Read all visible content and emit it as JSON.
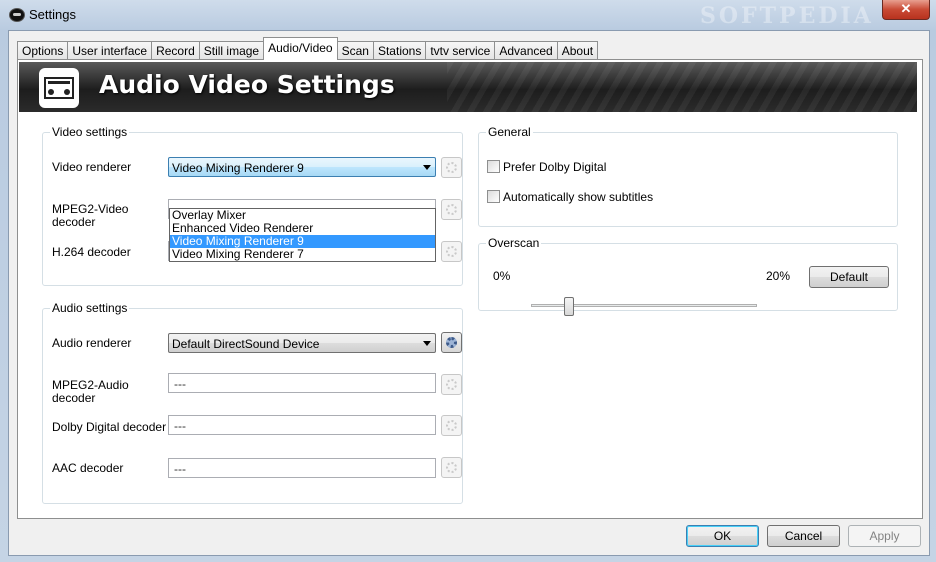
{
  "window": {
    "title": "Settings",
    "close_symbol": "✕",
    "watermark": "SOFTPEDIA"
  },
  "tabs": [
    {
      "label": "Options"
    },
    {
      "label": "User interface"
    },
    {
      "label": "Record"
    },
    {
      "label": "Still image"
    },
    {
      "label": "Audio/Video",
      "active": true
    },
    {
      "label": "Scan"
    },
    {
      "label": "Stations"
    },
    {
      "label": "tvtv service"
    },
    {
      "label": "Advanced"
    },
    {
      "label": "About"
    }
  ],
  "banner": {
    "title": "Audio Video Settings",
    "icon": "audio-video-device-icon"
  },
  "video": {
    "group_label": "Video settings",
    "renderer_label": "Video renderer",
    "renderer_value": "Video Mixing Renderer 9",
    "renderer_options": [
      "Overlay Mixer",
      "Enhanced Video Renderer",
      "Video Mixing Renderer 9",
      "Video Mixing Renderer 7"
    ],
    "renderer_selected_index": 2,
    "mpeg2_label_line1": "MPEG2-Video",
    "mpeg2_label_line2": "decoder",
    "h264_label": "H.264 decoder",
    "h264_value": "---"
  },
  "audio": {
    "group_label": "Audio settings",
    "renderer_label": "Audio renderer",
    "renderer_value": "Default DirectSound Device",
    "mpeg2_label_line1": "MPEG2-Audio",
    "mpeg2_label_line2": "decoder",
    "mpeg2_value": "---",
    "dolby_label": "Dolby Digital decoder",
    "dolby_value": "---",
    "aac_label": "AAC decoder",
    "aac_value": "---"
  },
  "general": {
    "group_label": "General",
    "prefer_dolby_label": "Prefer Dolby Digital",
    "prefer_dolby_checked": false,
    "auto_subtitles_label": "Automatically show subtitles",
    "auto_subtitles_checked": false
  },
  "overscan": {
    "group_label": "Overscan",
    "min_label": "0%",
    "max_label": "20%",
    "value_fraction": 0.17,
    "default_button": "Default"
  },
  "footer": {
    "ok": "OK",
    "cancel": "Cancel",
    "apply": "Apply"
  }
}
